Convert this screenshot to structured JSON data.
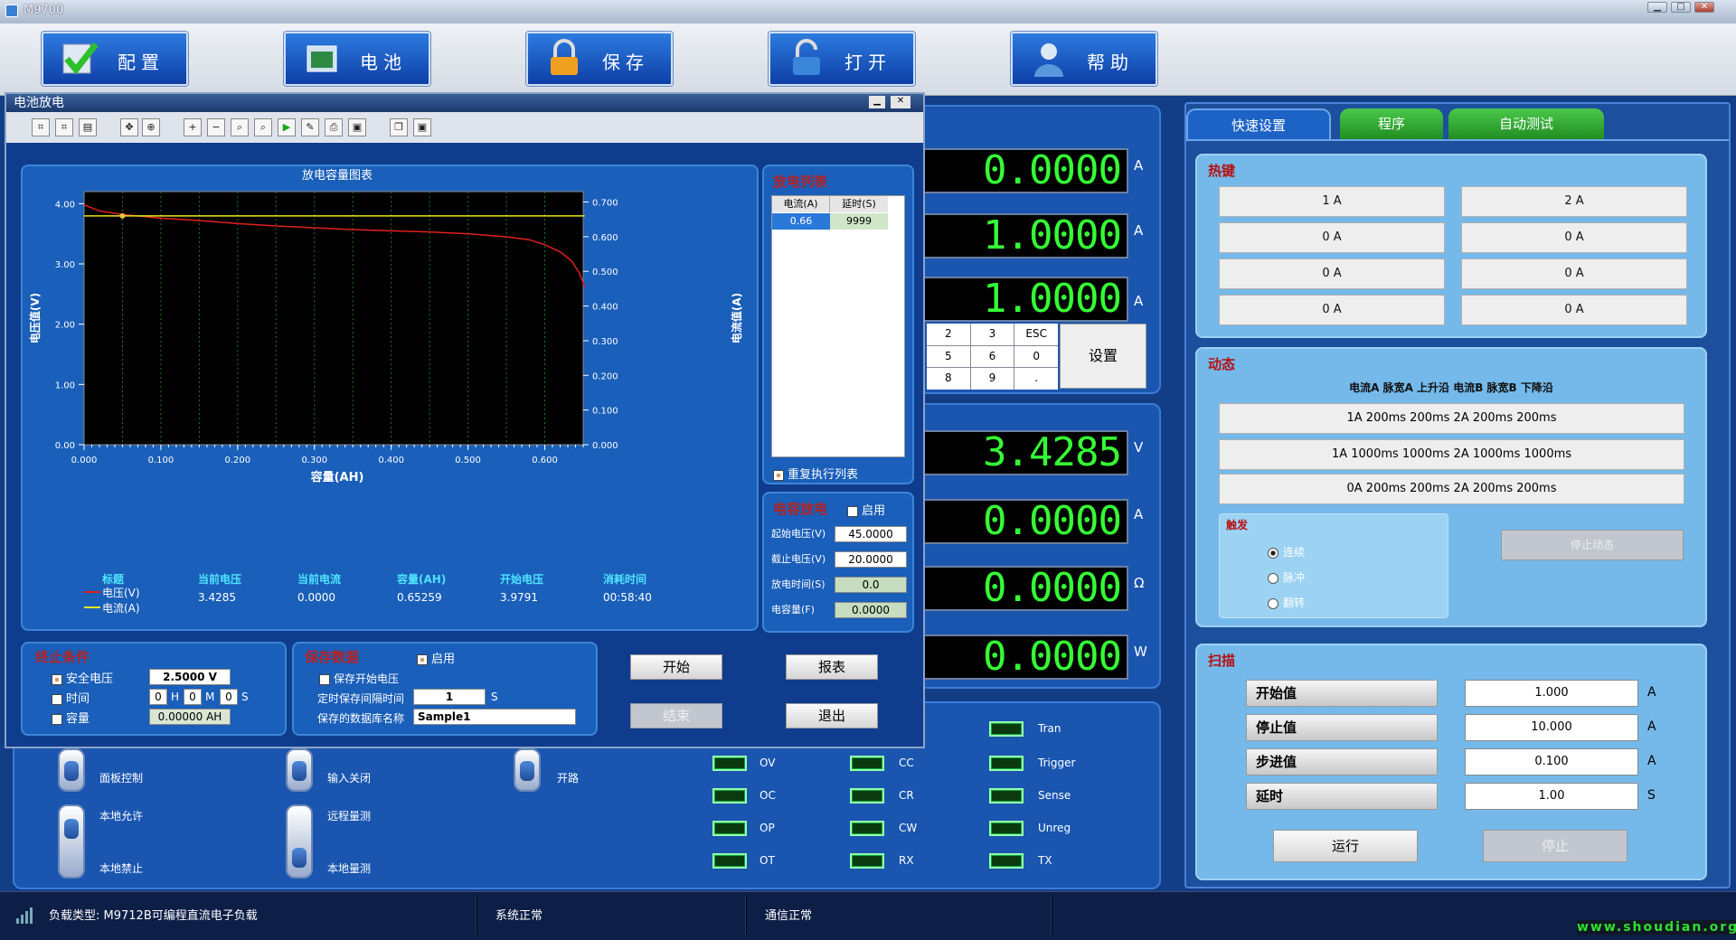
{
  "app": {
    "title": "M9700"
  },
  "toolbar": {
    "config": "配置",
    "battery": "电池",
    "save": "保存",
    "open": "打开",
    "help": "帮助"
  },
  "readouts": {
    "r1": {
      "value": "0.0000",
      "unit": "A"
    },
    "r2": {
      "value": "1.0000",
      "unit": "A"
    },
    "r3": {
      "value": "1.0000",
      "unit": "A"
    },
    "voltage": {
      "value": "3.4285",
      "unit": "V"
    },
    "current": {
      "value": "0.0000",
      "unit": "A"
    },
    "resistance": {
      "value": "0.0000",
      "unit": "Ω"
    },
    "power": {
      "value": "0.0000",
      "unit": "W"
    }
  },
  "keypad": {
    "keys": [
      "2",
      "3",
      "ESC",
      "5",
      "6",
      "0",
      "8",
      "9",
      "."
    ],
    "set_label": "设置"
  },
  "switches": {
    "panel_control": "面板控制",
    "local_allow": "本地允许",
    "local_forbid": "本地禁止",
    "input_close": "输入关闭",
    "remote_sense": "远程量测",
    "local_sense": "本地量测",
    "open_circuit": "开路"
  },
  "leds": {
    "ov": "OV",
    "oc": "OC",
    "op": "OP",
    "ot": "OT",
    "cc": "CC",
    "cr": "CR",
    "cw": "CW",
    "rx": "RX",
    "tran": "Tran",
    "trigger": "Trigger",
    "sense": "Sense",
    "unreg": "Unreg",
    "tx": "TX"
  },
  "right": {
    "tabs": [
      "快速设置",
      "程序",
      "自动测试"
    ],
    "hotkeys_title": "热键",
    "hotkeys": [
      "1 A",
      "2 A",
      "0 A",
      "0 A",
      "0 A",
      "0 A",
      "0 A",
      "0 A"
    ],
    "dynamic_title": "动态",
    "dynamic_header": "电流A 脉宽A 上升沿 电流B 脉宽B 下降沿",
    "dynamic_items": [
      "1A 200ms 200ms 2A 200ms 200ms",
      "1A 1000ms 1000ms 2A 1000ms 1000ms",
      "0A 200ms 200ms 2A 200ms 200ms"
    ],
    "trigger_title": "触发",
    "trigger_opts": [
      "连续",
      "脉冲",
      "翻转"
    ],
    "stop_dynamic": "停止动态",
    "scan_title": "扫描",
    "scan": [
      {
        "label": "开始值",
        "value": "1.000",
        "unit": "A"
      },
      {
        "label": "停止值",
        "value": "10.000",
        "unit": "A"
      },
      {
        "label": "步进值",
        "value": "0.100",
        "unit": "A"
      },
      {
        "label": "延时",
        "value": "1.00",
        "unit": "S"
      }
    ],
    "run": "运行",
    "stop": "停止"
  },
  "dialog": {
    "title": "电池放电",
    "list_title": "放电列表",
    "list_cols": [
      "电流(A)",
      "延时(S)"
    ],
    "list_rows": [
      [
        "0.66",
        "9999"
      ]
    ],
    "repeat": "重复执行列表",
    "cap_title": "电容放电",
    "cap_enable": "启用",
    "cap_fields": [
      {
        "label": "起始电压(V)",
        "value": "45.0000"
      },
      {
        "label": "截止电压(V)",
        "value": "20.0000"
      },
      {
        "label": "放电时间(S)",
        "value": "0.0"
      },
      {
        "label": "电容量(F)",
        "value": "0.0000"
      }
    ],
    "legend_header": [
      "标题",
      "当前电压",
      "当前电流",
      "容量(AH)",
      "开始电压",
      "消耗时间"
    ],
    "legend_values": [
      "3.4285",
      "0.0000",
      "0.65259",
      "3.9791",
      "00:58:40"
    ],
    "legend_v": "电压(V)",
    "legend_a": "电流(A)",
    "end_title": "终止条件",
    "end_safe": "安全电压",
    "end_safe_val": "2.5000 V",
    "end_time": "时间",
    "end_h": "0",
    "end_m": "0",
    "end_s": "0",
    "hl": "H",
    "ml": "M",
    "sl": "S",
    "end_cap": "容量",
    "end_cap_val": "0.00000 AH",
    "save_title": "保存数据",
    "save_enable": "启用",
    "save_start": "保存开始电压",
    "save_interval": "定时保存间隔时间",
    "save_interval_val": "1",
    "save_interval_unit": "S",
    "save_name": "保存的数据库名称",
    "save_name_val": "Sample1",
    "btn_start": "开始",
    "btn_report": "报表",
    "btn_end": "结束",
    "btn_exit": "退出"
  },
  "chart_data": {
    "type": "line",
    "title": "放电容量图表",
    "xlabel": "容量(AH)",
    "ylabel": "电压值(V)",
    "y2label": "电流值(A)",
    "xlim": [
      0,
      0.65
    ],
    "ylim": [
      0,
      4.2
    ],
    "y2lim": [
      0,
      0.73
    ],
    "xticks": [
      "0.000",
      "0.100",
      "0.200",
      "0.300",
      "0.400",
      "0.500",
      "0.600"
    ],
    "yticks": [
      "0.00",
      "1.00",
      "2.00",
      "3.00",
      "4.00"
    ],
    "y2ticks": [
      "0.000",
      "0.100",
      "0.200",
      "0.300",
      "0.400",
      "0.500",
      "0.600",
      "0.700"
    ],
    "series": [
      {
        "name": "电压(V)",
        "color": "#e02020",
        "axis": "y",
        "x": [
          0,
          0.02,
          0.05,
          0.1,
          0.15,
          0.2,
          0.25,
          0.3,
          0.35,
          0.4,
          0.45,
          0.5,
          0.55,
          0.58,
          0.6,
          0.62,
          0.635,
          0.645,
          0.652
        ],
        "y": [
          3.98,
          3.88,
          3.82,
          3.76,
          3.72,
          3.67,
          3.63,
          3.6,
          3.57,
          3.55,
          3.53,
          3.5,
          3.45,
          3.4,
          3.32,
          3.2,
          3.05,
          2.85,
          2.62
        ]
      },
      {
        "name": "电流(A)",
        "color": "#e8e820",
        "axis": "y2",
        "x": [
          0,
          0.652
        ],
        "y": [
          0.66,
          0.66
        ]
      }
    ]
  },
  "status": {
    "load_type": "负载类型: M9712B可编程直流电子负载",
    "sys": "系统正常",
    "comm": "通信正常",
    "website": "www.shoudian.org"
  }
}
